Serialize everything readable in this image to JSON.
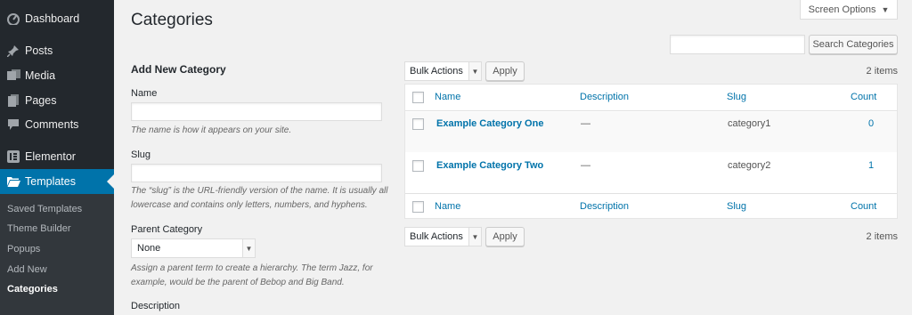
{
  "sidebar": {
    "items": [
      {
        "label": "Dashboard",
        "icon": "dashboard-icon"
      },
      {
        "label": "Posts",
        "icon": "pin-icon"
      },
      {
        "label": "Media",
        "icon": "media-icon"
      },
      {
        "label": "Pages",
        "icon": "page-icon"
      },
      {
        "label": "Comments",
        "icon": "comment-icon"
      },
      {
        "label": "Elementor",
        "icon": "elementor-icon"
      },
      {
        "label": "Templates",
        "icon": "folder-icon"
      }
    ],
    "submenu": [
      "Saved Templates",
      "Theme Builder",
      "Popups",
      "Add New",
      "Categories"
    ]
  },
  "header": {
    "title": "Categories",
    "screen_options": "Screen Options"
  },
  "search": {
    "button": "Search Categories",
    "value": ""
  },
  "form": {
    "heading": "Add New Category",
    "name_label": "Name",
    "name_help": "The name is how it appears on your site.",
    "slug_label": "Slug",
    "slug_help": "The “slug” is the URL-friendly version of the name. It is usually all lowercase and contains only letters, numbers, and hyphens.",
    "parent_label": "Parent Category",
    "parent_value": "None",
    "parent_help": "Assign a parent term to create a hierarchy. The term Jazz, for example, would be the parent of Bebop and Big Band.",
    "description_label": "Description"
  },
  "list": {
    "bulk_actions": "Bulk Actions",
    "apply": "Apply",
    "count": "2 items",
    "columns": {
      "name": "Name",
      "description": "Description",
      "slug": "Slug",
      "count": "Count"
    },
    "rows": [
      {
        "name": "Example Category One",
        "description": "—",
        "slug": "category1",
        "count": "0"
      },
      {
        "name": "Example Category Two",
        "description": "—",
        "slug": "category2",
        "count": "1"
      }
    ]
  },
  "colors": {
    "sidebar_bg": "#23282d",
    "accent": "#0073aa",
    "page_bg": "#f1f1f1"
  }
}
